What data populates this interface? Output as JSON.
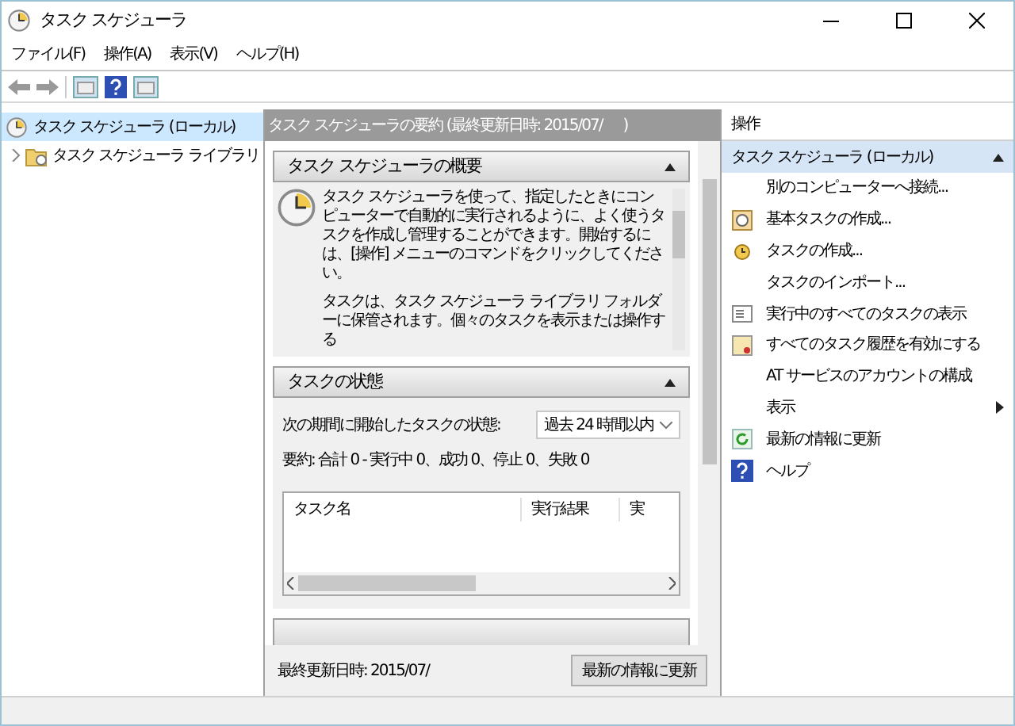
{
  "window": {
    "title": "タスク スケジューラ"
  },
  "menu": [
    {
      "label": "ファイル(F)"
    },
    {
      "label": "操作(A)"
    },
    {
      "label": "表示(V)"
    },
    {
      "label": "ヘルプ(H)"
    }
  ],
  "tree": [
    {
      "label": "タスク スケジューラ (ローカル)",
      "selected": true,
      "children": [
        {
          "label": "タスク スケジューラ ライブラリ",
          "selected": false,
          "expanded": false
        }
      ]
    }
  ],
  "summary": {
    "header": "タスク スケジューラの要約 (最終更新日時: 2015/07/      )",
    "overview": {
      "title": "タスク スケジューラの概要",
      "expanded": true,
      "paragraphs": [
        "タスク スケジューラを使って、指定したときにコンピューターで自動的に実行されるように、よく使うタスクを作成し管理することができます。開始するには、[操作] メニューのコマンドをクリックしてください。",
        "タスクは、タスク スケジューラ ライブラリ フォルダーに保管されます。個々のタスクを表示または操作する"
      ]
    },
    "status": {
      "title": "タスクの状態",
      "expanded": true,
      "filter_label": "次の期間に開始したタスクの状態:",
      "filter_value": "過去 24 時間以内",
      "totals": "要約: 合計 0 - 実行中 0、成功 0、停止 0、失敗 0",
      "columns": [
        "タスク名",
        "実行結果",
        "実"
      ]
    },
    "last_updated": "最終更新日時: 2015/07/",
    "refresh_button": "最新の情報に更新"
  },
  "actions": {
    "title": "操作",
    "group": {
      "title": "タスク スケジューラ (ローカル)",
      "expanded": true
    },
    "items": [
      {
        "label": "別のコンピューターへ接続...",
        "kind": "none",
        "submenu": false
      },
      {
        "label": "基本タスクの作成...",
        "kind": "basic-task",
        "submenu": false
      },
      {
        "label": "タスクの作成...",
        "kind": "task",
        "submenu": false
      },
      {
        "label": "タスクのインポート...",
        "kind": "none",
        "submenu": false
      },
      {
        "label": "実行中のすべてのタスクの表示",
        "kind": "running",
        "submenu": false
      },
      {
        "label": "すべてのタスク履歴を有効にする",
        "kind": "history",
        "submenu": false
      },
      {
        "label": "AT サービスのアカウントの構成",
        "kind": "none",
        "submenu": false
      },
      {
        "label": "表示",
        "kind": "none",
        "submenu": true
      },
      {
        "label": "最新の情報に更新",
        "kind": "refresh",
        "submenu": false
      },
      {
        "label": "ヘルプ",
        "kind": "help",
        "submenu": false
      }
    ]
  }
}
